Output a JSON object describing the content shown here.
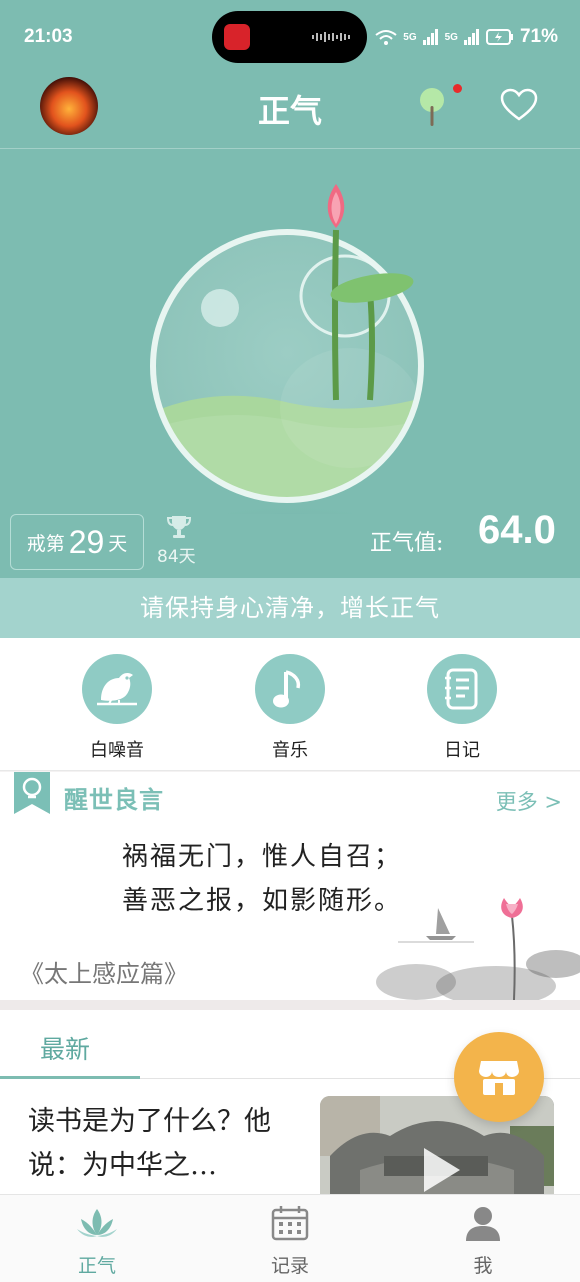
{
  "status_bar": {
    "time": "21:03",
    "network_1": "5G",
    "network_2": "5G",
    "battery": "71%"
  },
  "header": {
    "title": "正气",
    "avatar_icon": "phoenix-avatar",
    "tree_icon": "tree-icon",
    "heart_icon": "heart-icon"
  },
  "stats": {
    "quit_prefix": "戒第",
    "quit_days": "29",
    "quit_suffix": "天",
    "best_days": "84天",
    "zhengqi_label": "正气值:",
    "zhengqi_value": "64.0"
  },
  "slogan": "请保持身心清净，增长正气",
  "tools": [
    {
      "label": "白噪音",
      "icon": "bird-icon"
    },
    {
      "label": "音乐",
      "icon": "music-note-icon"
    },
    {
      "label": "日记",
      "icon": "notebook-icon"
    }
  ],
  "quote": {
    "heading": "醒世良言",
    "more": "更多 >",
    "line1": "祸福无门，惟人自召；",
    "line2": "善恶之报，如影随形。",
    "source": "《太上感应篇》"
  },
  "latest": {
    "tab": "最新",
    "article_title": "读书是为了什么？他说：为中华之…"
  },
  "nav": [
    {
      "label": "正气",
      "icon": "lotus-icon",
      "active": true
    },
    {
      "label": "记录",
      "icon": "calendar-icon",
      "active": false
    },
    {
      "label": "我",
      "icon": "user-icon",
      "active": false
    }
  ],
  "colors": {
    "theme": "#7dbcb1",
    "accent_fab": "#f3b44b",
    "active_nav": "#5fa9a0"
  }
}
